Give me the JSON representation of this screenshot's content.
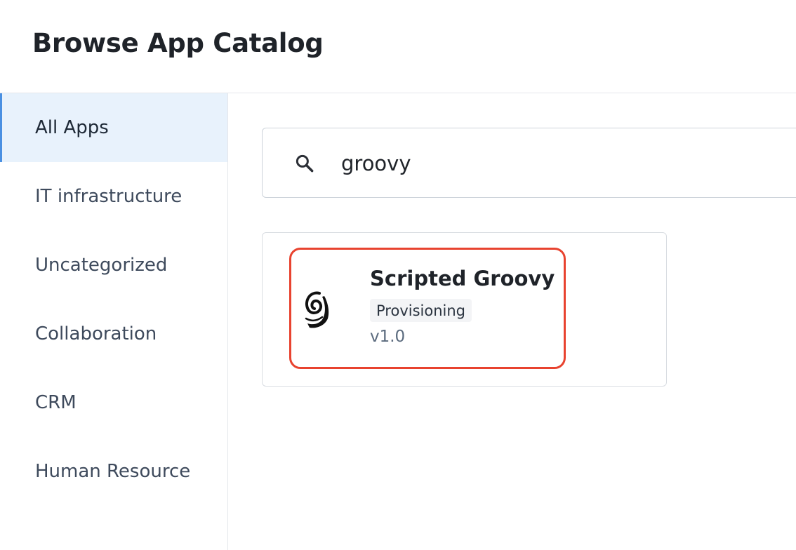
{
  "header": {
    "title": "Browse App Catalog"
  },
  "sidebar": {
    "items": [
      {
        "label": "All Apps",
        "active": true
      },
      {
        "label": "IT infrastructure",
        "active": false
      },
      {
        "label": "Uncategorized",
        "active": false
      },
      {
        "label": "Collaboration",
        "active": false
      },
      {
        "label": "CRM",
        "active": false
      },
      {
        "label": "Human Resource",
        "active": false
      }
    ]
  },
  "search": {
    "value": "groovy",
    "icon": "search-icon"
  },
  "results": [
    {
      "name": "Scripted Groovy",
      "tag": "Provisioning",
      "version": "v1.0",
      "icon": "groovy-logo-icon",
      "highlighted": true
    }
  ],
  "colors": {
    "accent": "#4a90e2",
    "active_bg": "#e8f2fc",
    "highlight": "#e8432f",
    "border": "#e5e7eb"
  }
}
